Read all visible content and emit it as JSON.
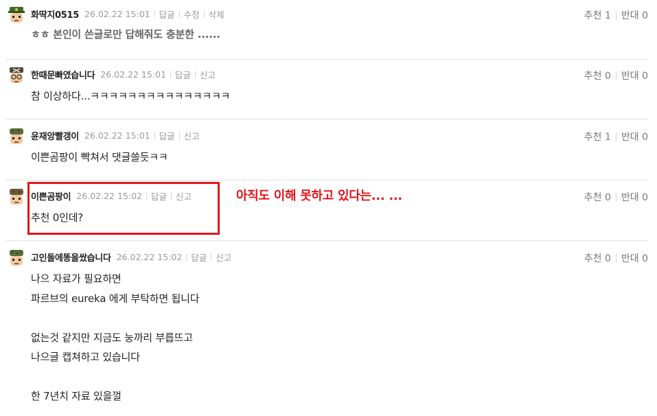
{
  "comments": [
    {
      "nickname": "화딱지0515",
      "date": "26.02.22 15:01",
      "actions": [
        "답글",
        "수정",
        "삭제"
      ],
      "body": [
        "ㅎㅎ 본인이 쓴글로만 답해줘도 충분한 ......"
      ],
      "body_bold": true,
      "up_label": "추천",
      "up": "1",
      "down_label": "반대",
      "down": "0"
    },
    {
      "nickname": "한때문빠였습니다",
      "date": "26.02.22 15:01",
      "actions": [
        "답글",
        "신고"
      ],
      "body": [
        "참 이상하다...ㅋㅋㅋㅋㅋㅋㅋㅋㅋㅋㅋㅋㅋㅋㅋ"
      ],
      "up_label": "추천",
      "up": "0",
      "down_label": "반대",
      "down": "0"
    },
    {
      "nickname": "윤재앙빨갱이",
      "date": "26.02.22 15:01",
      "actions": [
        "답글",
        "신고"
      ],
      "body": [
        "이쁜곰팡이 빡쳐서 댓글쓸듯ㅋㅋ"
      ],
      "up_label": "추천",
      "up": "1",
      "down_label": "반대",
      "down": "0"
    },
    {
      "nickname": "이쁜곰팡이",
      "date": "26.02.22 15:02",
      "actions": [
        "답글",
        "신고"
      ],
      "body": [
        "추천 0인데?"
      ],
      "up_label": "추천",
      "up": "0",
      "down_label": "반대",
      "down": "0"
    },
    {
      "nickname": "고인돌에똥을쌌습니다",
      "date": "26.02.22 15:02",
      "actions": [
        "답글",
        "신고"
      ],
      "body": [
        "나으 자료가 필요하면",
        "파르브의 eureka 에게 부탁하면 됩니다",
        "",
        "없는것 같지만 지금도 눙까리 부릅뜨고",
        "나으글 캡쳐하고 있습니다",
        "",
        "한 7년치 자료 있을껄"
      ],
      "up_label": "추천",
      "up": "0",
      "down_label": "반대",
      "down": "0"
    }
  ],
  "annotation": "아직도 이해 못하고 있다는... ...",
  "colors": {
    "highlight": "#e3151b",
    "text": "#222222",
    "meta": "#999999"
  },
  "avatar_icons": [
    "soldier-avatar-icon",
    "soldier-avatar-icon",
    "soldier-avatar-icon",
    "soldier-avatar-icon",
    "soldier-avatar-icon"
  ]
}
